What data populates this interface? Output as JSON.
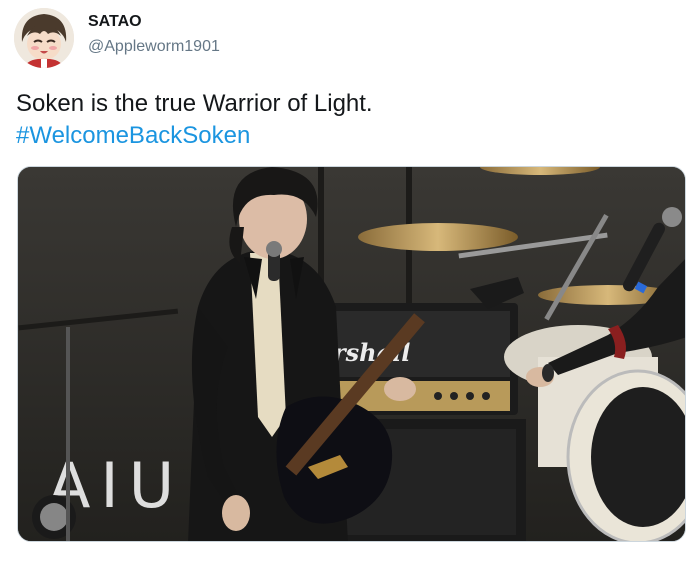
{
  "tweet": {
    "display_name": "SATAO",
    "handle": "@Appleworm1901",
    "text": "Soken is the true Warrior of Light.",
    "hashtag": "#WelcomeBackSoken"
  },
  "media": {
    "amp_brand": "rshall",
    "stage_text": "AIU"
  },
  "icons": {
    "avatar": "avatar-illustration",
    "photo": "concert-photo"
  },
  "colors": {
    "hashtag": "#1b95e0",
    "handle": "#657786",
    "text": "#14171a"
  }
}
